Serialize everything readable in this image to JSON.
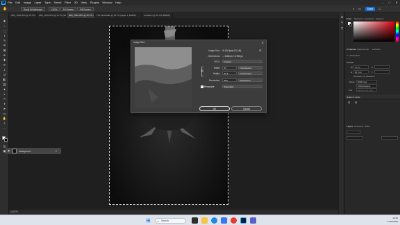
{
  "menubar": {
    "logo": "Ps",
    "items": [
      "File",
      "Edit",
      "Image",
      "Layer",
      "Type",
      "Select",
      "Filter",
      "3D",
      "View",
      "Plugins",
      "Window",
      "Help"
    ],
    "window_controls": [
      "–",
      "□",
      "✕"
    ]
  },
  "optionsbar": {
    "scroll_all": "Scroll All Windows",
    "zoom": "100%",
    "fit_screen": "Fit Screen",
    "fill_screen": "Fill Screen",
    "share": "Share"
  },
  "tabs": [
    "IMG_7248.JPG @ 16.7% (RGB/8#)",
    "IMG_7250.JPG @ 16.7% (RGB/8#)",
    "IMG_7252.JPG @ 16.7% (RGB/8)",
    "The Final Mark @ 16.7% (Layer 1, RGB/8)",
    "Untitled-1 @ 16.7% (RGB/8)"
  ],
  "status": {
    "zoom": "16.67%",
    "info": ""
  },
  "dialog": {
    "title": "Image Size",
    "close": "✕",
    "image_size_label": "Image Size:",
    "image_size_value": "41.6M (was 51.1M)",
    "dimensions_label": "Dimensions:",
    "dimensions_value": "⌄ 3188 px × 4780 px",
    "fit_to_label": "Fit To:",
    "fit_to_value": "Custom",
    "width_label": "Width:",
    "width_value": "27",
    "width_unit": "Centimeters",
    "height_label": "Height:",
    "height_value": "40.5",
    "height_unit": "Centimeters",
    "resolution_label": "Resolution:",
    "resolution_value": "300",
    "resolution_unit": "Pixels/Inch",
    "resample_label": "Resample:",
    "resample_value": "Automatic",
    "ok": "OK",
    "cancel": "Cancel"
  },
  "right_panel": {
    "color_tabs": [
      "Color",
      "Swatches",
      "Gradients",
      "Patterns"
    ],
    "properties_tabs": [
      "Properties",
      "Adjustments",
      "Libraries"
    ],
    "document_label": "Document",
    "canvas_label": "Canvas",
    "w_label": "W",
    "h_label": "H",
    "x_label": "X",
    "y_label": "Y",
    "w_value": "27 cm",
    "h_value": "40.5 cm",
    "resolution_text": "Resolution: 72 pixels/inch",
    "mode_label": "Mode",
    "mode_value": "RGB Color",
    "depth_value": "8 Bits/Channel",
    "fill_label": "Fill",
    "fill_value": "Background Color",
    "rulers_label": "Rulers & Grids",
    "layer_tabs": [
      "Layers",
      "Channels",
      "Paths"
    ],
    "layer_name": "Background"
  },
  "taskbar": {
    "search_placeholder": "Search",
    "time": "10:30",
    "date": "27/01/2024"
  },
  "colors": {
    "accent": "#1473e6",
    "panel": "#282828",
    "dialog": "#3c3c3c"
  }
}
